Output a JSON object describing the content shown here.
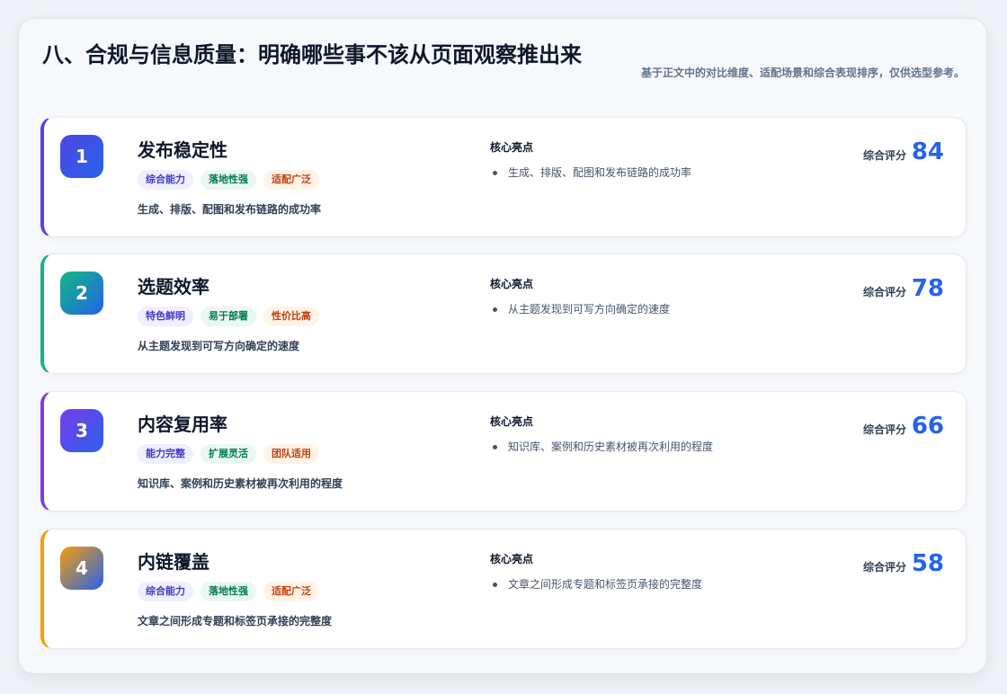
{
  "header": {
    "title": "八、合规与信息质量：明确哪些事不该从页面观察推出来",
    "subtitle": "基于正文中的对比维度、适配场景和综合表现排序，仅供选型参考。"
  },
  "labels": {
    "highlights_title": "核心亮点",
    "score_label": "综合评分"
  },
  "colors": {
    "score": "#2563eb",
    "accent_1": "#4f46e5",
    "accent_2": "#10b981",
    "accent_3": "#7c3aed",
    "accent_4": "#f59e0b"
  },
  "cards": [
    {
      "rank": "1",
      "name": "发布稳定性",
      "tags": [
        "综合能力",
        "落地性强",
        "适配广泛"
      ],
      "description": "生成、排版、配图和发布链路的成功率",
      "highlight": "生成、排版、配图和发布链路的成功率",
      "score": "84"
    },
    {
      "rank": "2",
      "name": "选题效率",
      "tags": [
        "特色鲜明",
        "易于部署",
        "性价比高"
      ],
      "description": "从主题发现到可写方向确定的速度",
      "highlight": "从主题发现到可写方向确定的速度",
      "score": "78"
    },
    {
      "rank": "3",
      "name": "内容复用率",
      "tags": [
        "能力完整",
        "扩展灵活",
        "团队适用"
      ],
      "description": "知识库、案例和历史素材被再次利用的程度",
      "highlight": "知识库、案例和历史素材被再次利用的程度",
      "score": "66"
    },
    {
      "rank": "4",
      "name": "内链覆盖",
      "tags": [
        "综合能力",
        "落地性强",
        "适配广泛"
      ],
      "description": "文章之间形成专题和标签页承接的完整度",
      "highlight": "文章之间形成专题和标签页承接的完整度",
      "score": "58"
    }
  ]
}
